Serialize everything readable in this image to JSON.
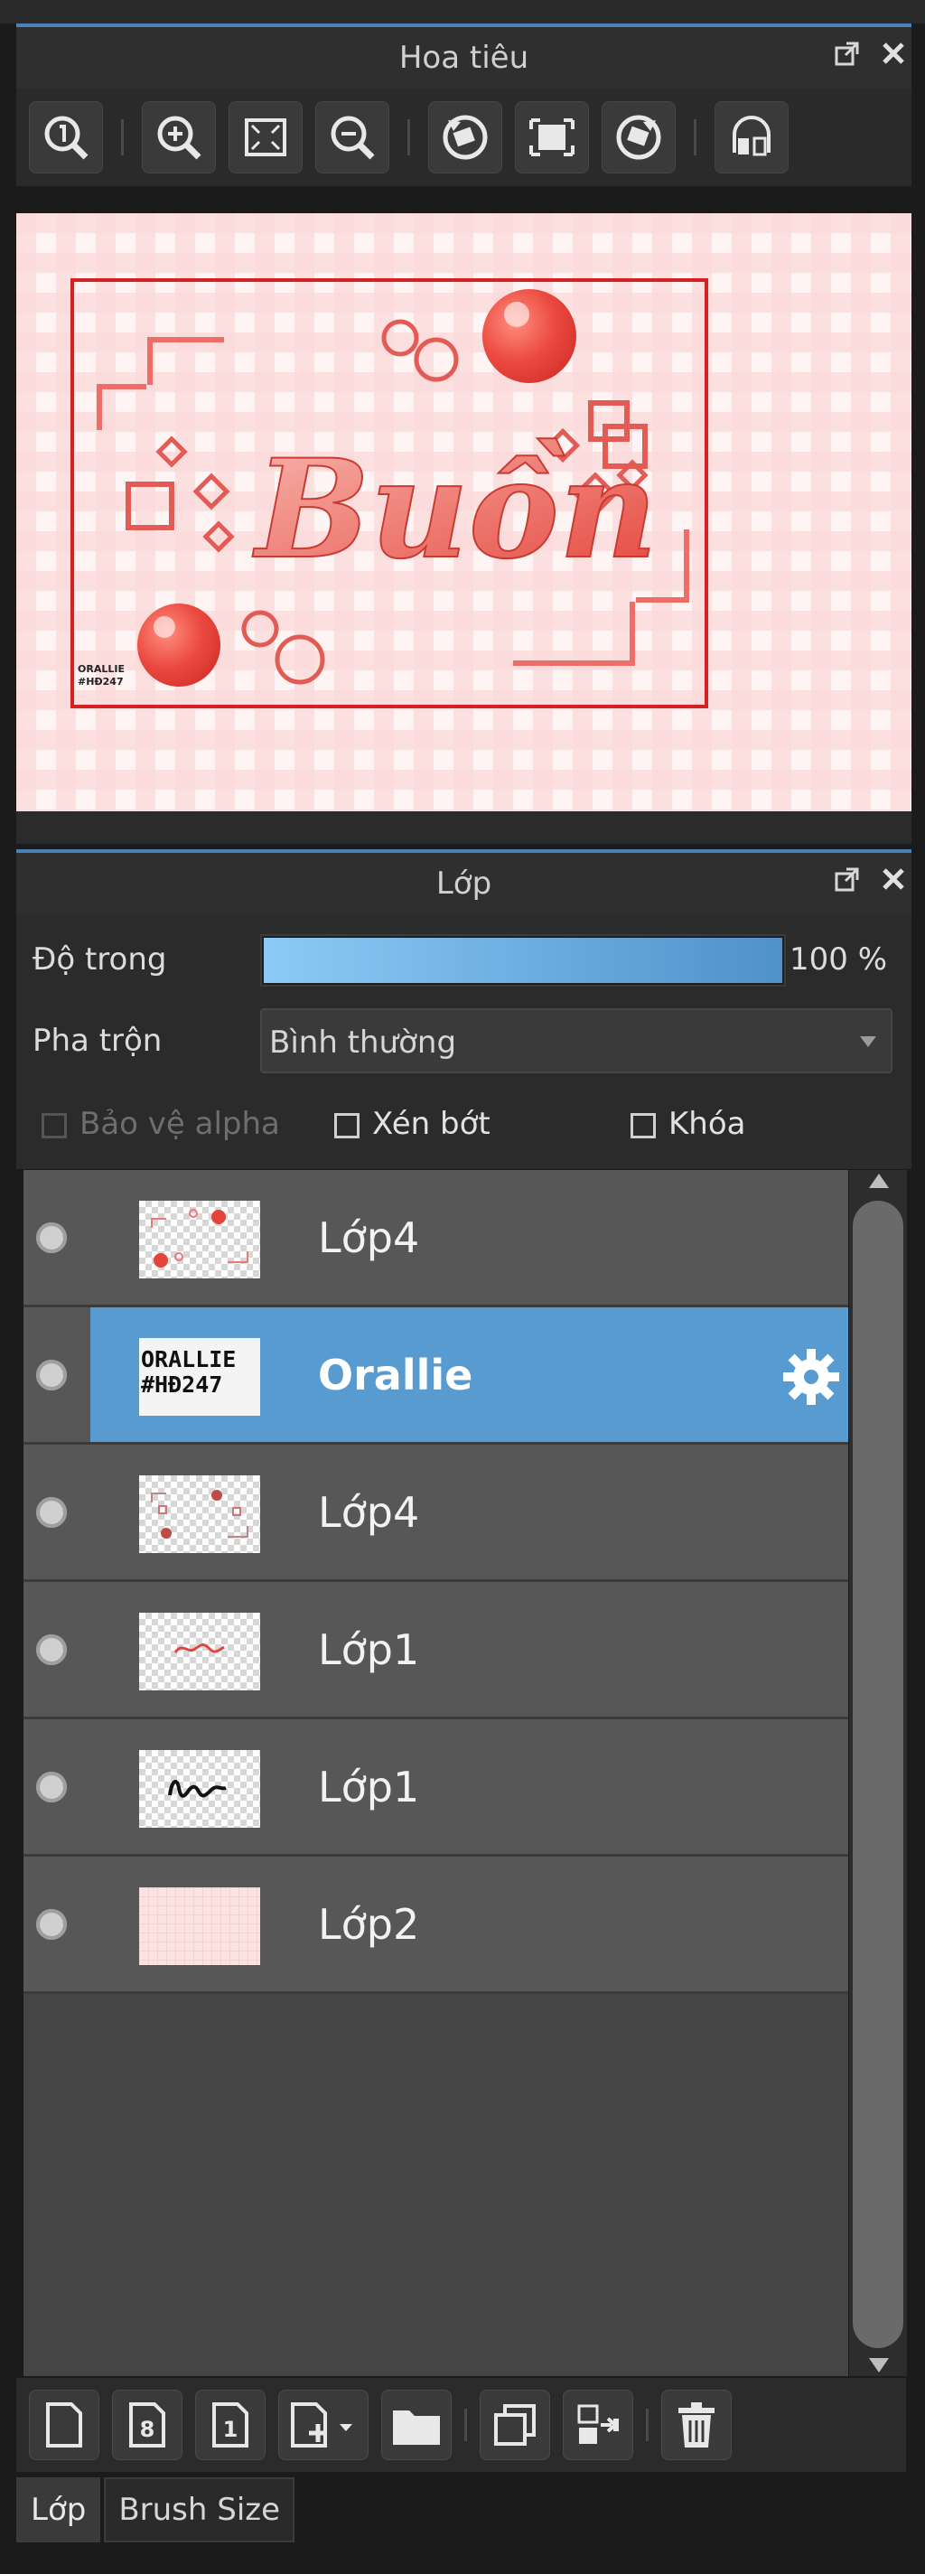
{
  "navigator": {
    "title": "Hoa tiêu",
    "toolbar_icons": [
      "zoom-100-icon",
      "zoom-in-icon",
      "fit-screen-icon",
      "zoom-out-icon",
      "rotate-left-icon",
      "reset-view-icon",
      "rotate-right-icon",
      "flip-horizontal-icon"
    ]
  },
  "preview": {
    "artwork_title": "Buồn",
    "watermark": "ORALLIE\n#HĐ247"
  },
  "layers_panel": {
    "title": "Lớp",
    "opacity_label": "Độ trong",
    "opacity_value": "100 %",
    "opacity_fraction": 1.0,
    "blend_label": "Pha trộn",
    "blend_value": "Bình thường",
    "protect_alpha_label": "Bảo vệ alpha",
    "clip_label": "Xén bớt",
    "lock_label": "Khóa",
    "layers": [
      {
        "name": "Lớp4",
        "selected": false
      },
      {
        "name": "Orallie",
        "selected": true,
        "thumb_text": "ORALLIE\n#HĐ247"
      },
      {
        "name": "Lớp4",
        "selected": false
      },
      {
        "name": "Lớp1",
        "selected": false
      },
      {
        "name": "Lớp1",
        "selected": false
      },
      {
        "name": "Lớp2",
        "selected": false
      }
    ]
  },
  "bottom_toolbar_icons": [
    "new-layer-icon",
    "new-8bit-layer-icon",
    "new-1bit-layer-icon",
    "add-layer-menu-icon",
    "new-folder-icon",
    "duplicate-layer-icon",
    "merge-down-icon",
    "delete-layer-icon"
  ],
  "bottom_tabs": [
    {
      "label": "Lớp",
      "active": true
    },
    {
      "label": "Brush Size",
      "active": false
    }
  ],
  "colors": {
    "accent_blue": "#579bd0",
    "panel_bg": "#2b2b2b",
    "art_red": "#e8463f",
    "art_pink": "#f6c9c5"
  }
}
